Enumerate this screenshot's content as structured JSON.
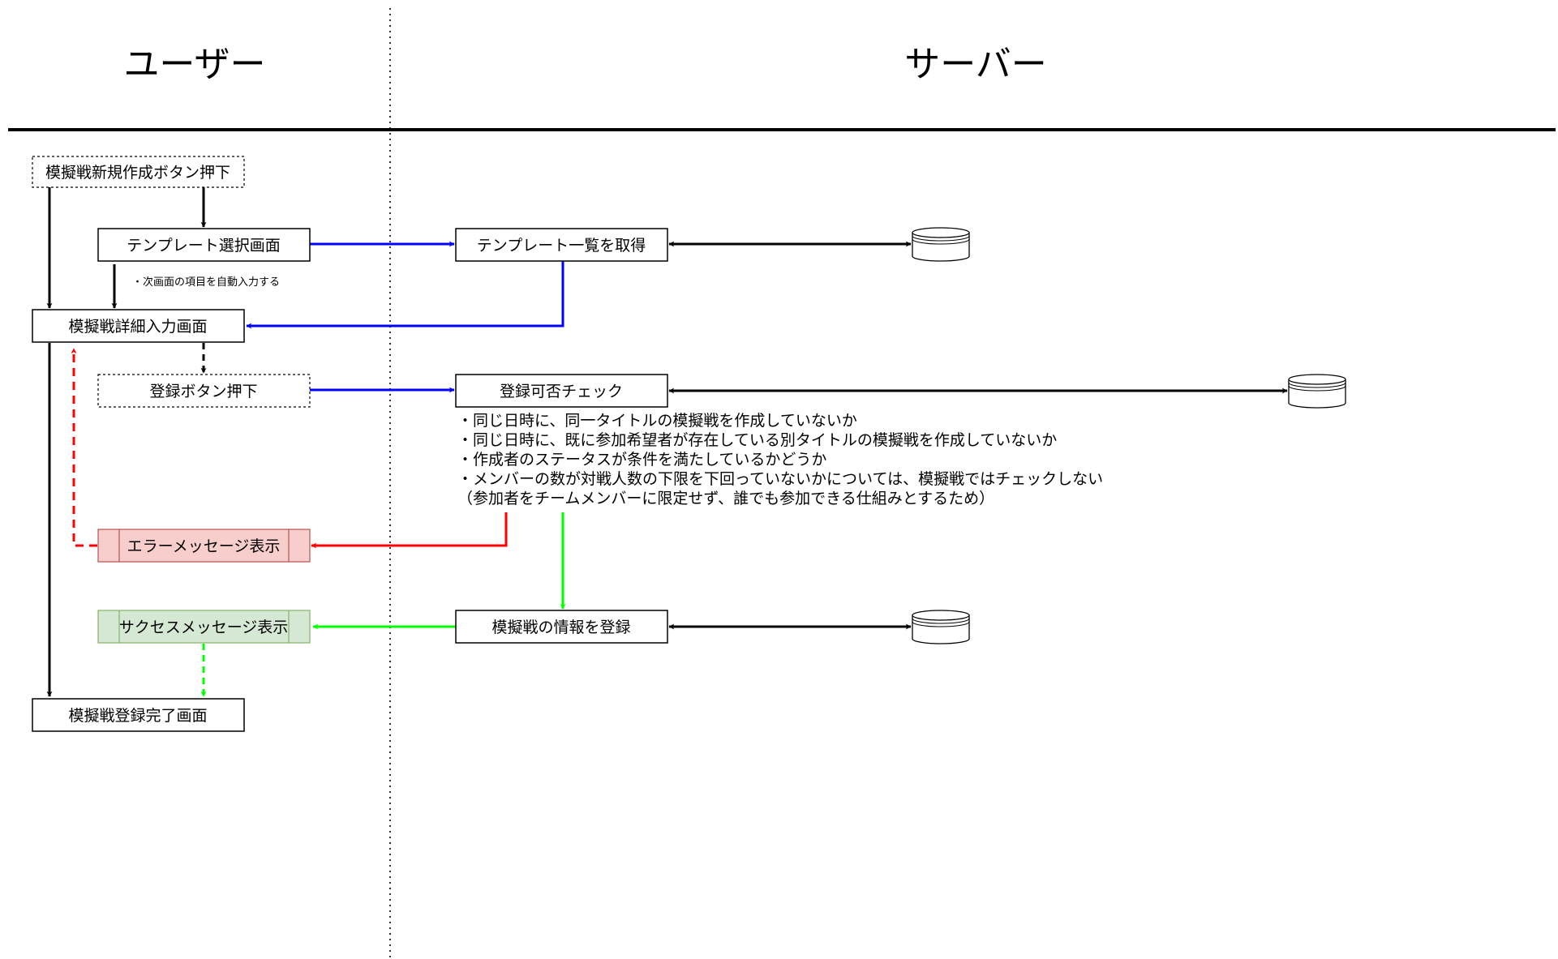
{
  "lanes": {
    "user": "ユーザー",
    "server": "サーバー"
  },
  "nodes": {
    "create_button": "模擬戦新規作成ボタン押下",
    "template_select": "テンプレート選択画面",
    "template_list": "テンプレート一覧を取得",
    "detail_input": "模擬戦詳細入力画面",
    "register_button": "登録ボタン押下",
    "register_check": "登録可否チェック",
    "error_message": "エラーメッセージ表示",
    "success_message": "サクセスメッセージ表示",
    "save_info": "模擬戦の情報を登録",
    "complete_screen": "模擬戦登録完了画面"
  },
  "notes": {
    "autofill": "・次画面の項目を自動入力する",
    "check_items": [
      "・同じ日時に、同一タイトルの模擬戦を作成していないか",
      "・同じ日時に、既に参加希望者が存在している別タイトルの模擬戦を作成していないか",
      "・作成者のステータスが条件を満たしているかどうか",
      "・メンバーの数が対戦人数の下限を下回っていないかについては、模擬戦ではチェックしない",
      "（参加者をチームメンバーに限定せず、誰でも参加できる仕組みとするため）"
    ]
  },
  "colors": {
    "blue": "#0000ff",
    "red": "#ff0000",
    "green": "#00ff00",
    "black": "#000000",
    "error_fill": "#f8cecc",
    "error_stroke": "#b85450",
    "success_fill": "#d5e8d4",
    "success_stroke": "#82b366"
  }
}
